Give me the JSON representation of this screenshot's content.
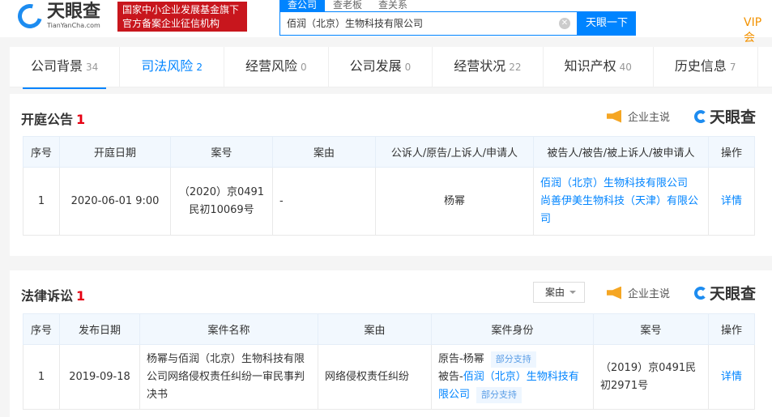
{
  "header": {
    "logo_cn": "天眼查",
    "logo_en": "TianYanCha.com",
    "badge_line1": "国家中小企业发展基金旗下",
    "badge_line2": "官方备案企业征信机构",
    "search_tabs": [
      "查公司",
      "查老板",
      "查关系"
    ],
    "search_value": "佰润（北京）生物科技有限公司",
    "search_button": "天眼一下",
    "vip": "VIP会"
  },
  "tabs": [
    {
      "label": "公司背景",
      "count": "34"
    },
    {
      "label": "司法风险",
      "count": "2"
    },
    {
      "label": "经营风险",
      "count": "0"
    },
    {
      "label": "公司发展",
      "count": "0"
    },
    {
      "label": "经营状况",
      "count": "22"
    },
    {
      "label": "知识产权",
      "count": "40"
    },
    {
      "label": "历史信息",
      "count": "7"
    }
  ],
  "brand": {
    "say": "企业主说",
    "logo": "天眼查"
  },
  "court": {
    "title": "开庭公告",
    "count": "1",
    "headers": [
      "序号",
      "开庭日期",
      "案号",
      "案由",
      "公诉人/原告/上诉人/申请人",
      "被告人/被告/被上诉人/被申请人",
      "操作"
    ],
    "rows": [
      {
        "no": "1",
        "date": "2020-06-01 9:00",
        "case_no": "（2020）京0491民初10069号",
        "cause": "-",
        "plaintiff": "杨幂",
        "defendant1": "佰润（北京）生物科技有限公司",
        "defendant2": "尚善伊美生物科技（天津）有限公司",
        "action": "详情"
      }
    ]
  },
  "lawsuit": {
    "title": "法律诉讼",
    "count": "1",
    "filter": "案由",
    "headers": [
      "序号",
      "发布日期",
      "案件名称",
      "案由",
      "案件身份",
      "案号",
      "操作"
    ],
    "rows": [
      {
        "no": "1",
        "date": "2019-09-18",
        "name": "杨幂与佰润（北京）生物科技有限公司网络侵权责任纠纷一审民事判决书",
        "cause": "网络侵权责任纠纷",
        "role1_prefix": "原告-杨幂",
        "role1_tag": "部分支持",
        "role2_prefix": "被告-",
        "role2_link": "佰润（北京）生物科技有限公司",
        "role2_tag": "部分支持",
        "case_no": "（2019）京0491民初2971号",
        "action": "详情"
      }
    ]
  }
}
